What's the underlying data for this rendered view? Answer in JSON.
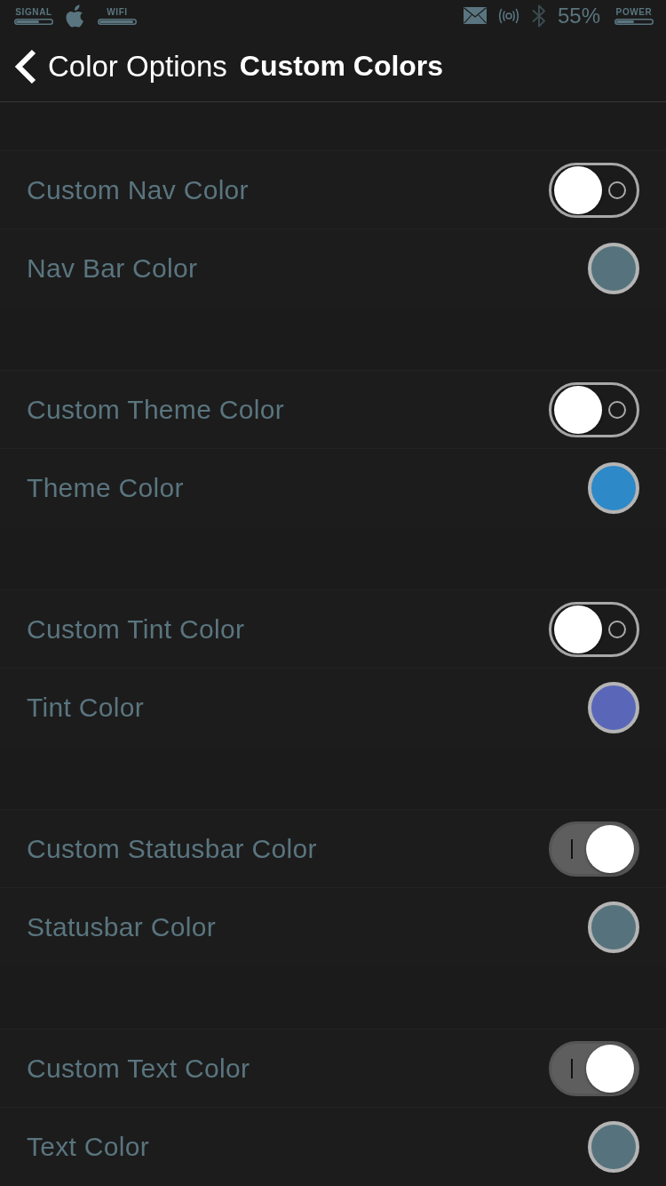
{
  "status_bar": {
    "signal_label": "SIGNAL",
    "wifi_label": "WIFI",
    "battery_percent": "55%",
    "power_label": "POWER"
  },
  "nav_bar": {
    "back_label": "Color Options",
    "title": "Custom Colors"
  },
  "groups": [
    {
      "rows": [
        {
          "kind": "switch",
          "label": "Custom Nav Color",
          "on": false
        },
        {
          "kind": "color",
          "label": "Nav Bar Color",
          "color": "#56737d"
        }
      ]
    },
    {
      "rows": [
        {
          "kind": "switch",
          "label": "Custom Theme Color",
          "on": false
        },
        {
          "kind": "color",
          "label": "Theme Color",
          "color": "#2d89c8"
        }
      ]
    },
    {
      "rows": [
        {
          "kind": "switch",
          "label": "Custom Tint Color",
          "on": false
        },
        {
          "kind": "color",
          "label": "Tint Color",
          "color": "#5a67b8"
        }
      ]
    },
    {
      "rows": [
        {
          "kind": "switch",
          "label": "Custom Statusbar Color",
          "on": true
        },
        {
          "kind": "color",
          "label": "Statusbar Color",
          "color": "#56737d"
        }
      ]
    },
    {
      "rows": [
        {
          "kind": "switch",
          "label": "Custom Text Color",
          "on": true
        },
        {
          "kind": "color",
          "label": "Text Color",
          "color": "#56737d"
        }
      ]
    }
  ]
}
